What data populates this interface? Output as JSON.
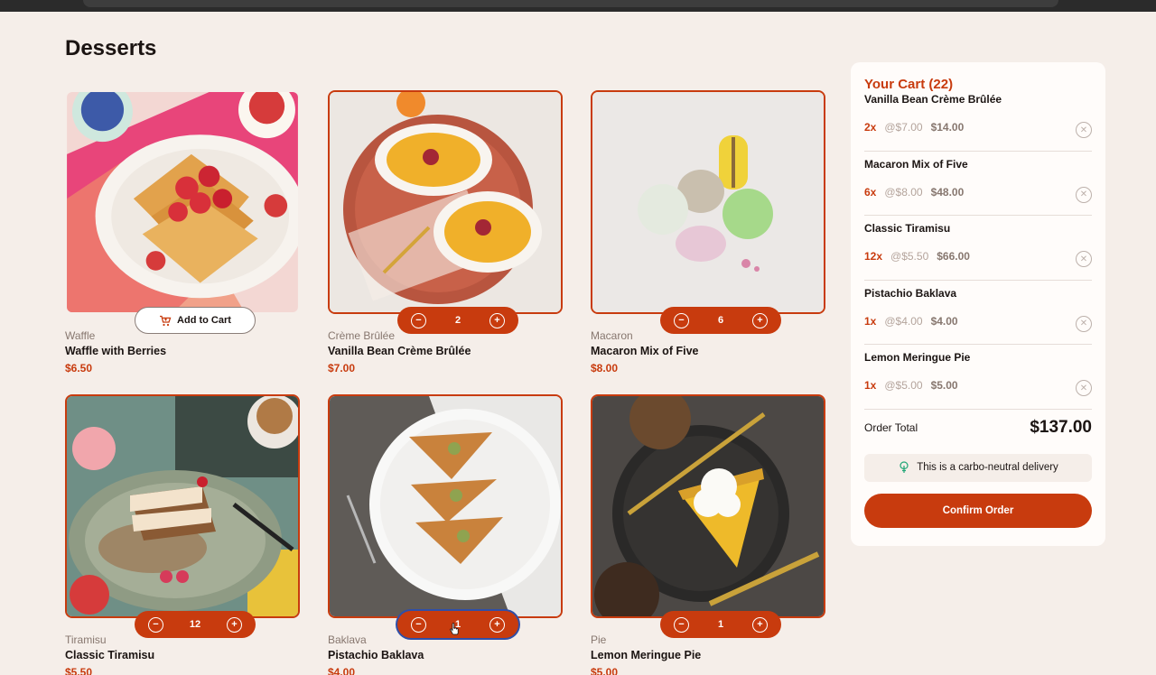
{
  "page": {
    "title": "Desserts"
  },
  "products": [
    {
      "category": "Waffle",
      "name": "Waffle with Berries",
      "price": "$6.50",
      "in_cart": false,
      "add_label": "Add to Cart"
    },
    {
      "category": "Crème Brûlée",
      "name": "Vanilla Bean Crème Brûlée",
      "price": "$7.00",
      "in_cart": true,
      "qty": "2"
    },
    {
      "category": "Macaron",
      "name": "Macaron Mix of Five",
      "price": "$8.00",
      "in_cart": true,
      "qty": "6"
    },
    {
      "category": "Tiramisu",
      "name": "Classic Tiramisu",
      "price": "$5.50",
      "in_cart": true,
      "qty": "12"
    },
    {
      "category": "Baklava",
      "name": "Pistachio Baklava",
      "price": "$4.00",
      "in_cart": true,
      "qty": "1"
    },
    {
      "category": "Pie",
      "name": "Lemon Meringue Pie",
      "price": "$5.00",
      "in_cart": true,
      "qty": "1"
    }
  ],
  "stepper": {
    "minus": "−",
    "plus": "+"
  },
  "cart": {
    "title": "Your Cart (22)",
    "items": [
      {
        "name": "Vanilla Bean Crème Brûlée",
        "qty": "2x",
        "unit": "@$7.00",
        "total": "$14.00"
      },
      {
        "name": "Macaron Mix of Five",
        "qty": "6x",
        "unit": "@$8.00",
        "total": "$48.00"
      },
      {
        "name": "Classic Tiramisu",
        "qty": "12x",
        "unit": "@$5.50",
        "total": "$66.00"
      },
      {
        "name": "Pistachio Baklava",
        "qty": "1x",
        "unit": "@$4.00",
        "total": "$4.00"
      },
      {
        "name": "Lemon Meringue Pie",
        "qty": "1x",
        "unit": "@$5.00",
        "total": "$5.00"
      }
    ],
    "order_total_label": "Order Total",
    "order_total": "$137.00",
    "carbon_text": "This is a carbo-neutral delivery",
    "confirm_label": "Confirm Order"
  },
  "colors": {
    "accent": "#c83b0e",
    "background": "#f5eee9",
    "text": "#1b1412",
    "muted": "#87776f"
  }
}
